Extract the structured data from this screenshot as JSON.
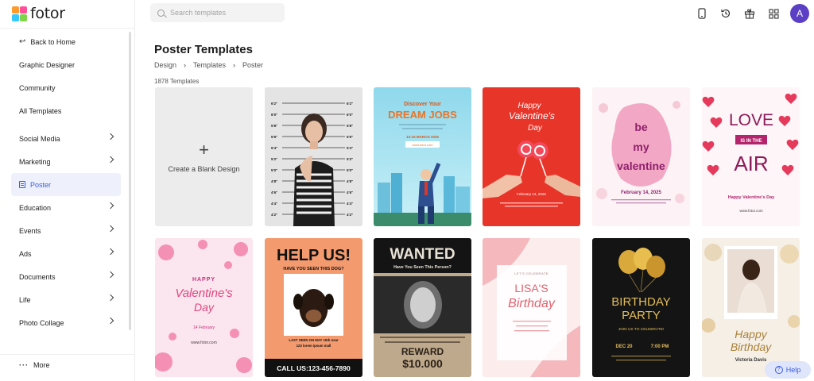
{
  "app": {
    "logo_text": "fotor"
  },
  "search": {
    "placeholder": "Search templates"
  },
  "sidebar": {
    "back": "Back to Home",
    "items": [
      {
        "label": "Graphic Designer"
      },
      {
        "label": "Community"
      },
      {
        "label": "All Templates"
      },
      {
        "label": "Social Media"
      },
      {
        "label": "Marketing"
      },
      {
        "label": "Poster"
      },
      {
        "label": "Education"
      },
      {
        "label": "Events"
      },
      {
        "label": "Ads"
      },
      {
        "label": "Documents"
      },
      {
        "label": "Life"
      },
      {
        "label": "Photo Collage"
      }
    ],
    "more": "More"
  },
  "user": {
    "avatar_initial": "A"
  },
  "main": {
    "title": "Poster Templates",
    "breadcrumb": [
      "Design",
      "Templates",
      "Poster"
    ],
    "count": "1878 Templates",
    "blank_label": "Create a Blank Design",
    "blank_plus": "+"
  },
  "templates": {
    "t1": {
      "marks": [
        "6'2\"",
        "6'0\"",
        "5'8\"",
        "5'6\"",
        "5'4\"",
        "5'2\"",
        "5'0\"",
        "4'8\"",
        "4'6\"",
        "4'4\"",
        "4'2\""
      ]
    },
    "t2": {
      "line1": "Discover Your",
      "line2": "DREAM JOBS",
      "date": "12-15 MARCH 2025",
      "url": "www.fotor.com"
    },
    "t3": {
      "script1": "Happy",
      "script2": "Valentine's",
      "script3": "Day",
      "date": "February 14, 2025"
    },
    "t4": {
      "w1": "be",
      "w2": "my",
      "w3": "valentine",
      "date": "February 14, 2025"
    },
    "t5": {
      "w1": "LOVE",
      "w2": "IS IN THE",
      "w3": "AIR",
      "sub": "Happy Valentine's Day",
      "url": "www.fotor.com"
    },
    "t6": {
      "w1": "HAPPY",
      "w2": "Valentine's",
      "w3": "Day",
      "date": "14 February",
      "url": "www.fotor.com"
    },
    "t7": {
      "title": "HELP US!",
      "sub": "HAVE YOU SEEN THIS DOG?",
      "info1": "LAST SEEN ON MAY 15th near",
      "info2": "123 lorem ipsum mall",
      "call": "CALL US:123-456-7890"
    },
    "t8": {
      "title": "WANTED",
      "sub": "Have You Seen This Person?",
      "reward": "REWARD",
      "amount": "$10.000"
    },
    "t9": {
      "lets": "LET'S CELEBRATE",
      "name": "LISA'S",
      "script": "Birthday"
    },
    "t10": {
      "w1": "BIRTHDAY",
      "w2": "PARTY",
      "sub": "JOIN US TO CELEBRATE!",
      "date": "DEC 20",
      "time": "7:00 PM"
    },
    "t11": {
      "w1": "Happy",
      "w2": "Birthday",
      "name": "Victoria Davis"
    }
  },
  "help": {
    "label": "Help"
  },
  "colors": {
    "accent": "#3b5bdb",
    "avatar": "#5b3fc4"
  }
}
